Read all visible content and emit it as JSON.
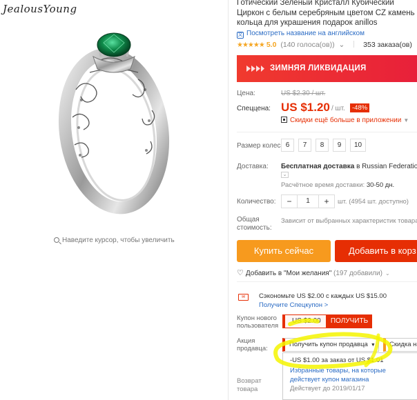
{
  "brand": "JealousYoung",
  "zoom_hint": "Наведите курсор, чтобы увеличить",
  "product": {
    "title": "Готический Зеленый Кристалл Кубический Циркон с белым серебряным цветом CZ камень кольца для украшения подарок anillos",
    "translate_label": "Посмотреть название на английском",
    "rating_stars": "★★★★★",
    "rating_score": "5.0",
    "rating_votes": "(140 голоса(ов))",
    "orders": "353 заказа(ов)"
  },
  "banner": {
    "text": "ЗИМНЯЯ ЛИКВИДАЦИЯ"
  },
  "price": {
    "label_price": "Цена:",
    "old": "US $2.30 / шт.",
    "label_special": "Спеццена:",
    "new": "US $1.20",
    "per": "/ шт.",
    "discount": "-48%",
    "app_deal": "Скидки ещё больше в приложении",
    "app_caret": "▼"
  },
  "size": {
    "label": "Размер колеса:",
    "options": [
      "6",
      "7",
      "8",
      "9",
      "10"
    ]
  },
  "shipping": {
    "label": "Доставка:",
    "text": "Бесплатная доставка",
    "to": "в Russian Federation с",
    "time_label": "Расчётное время доставки:",
    "time": "30-50 дн."
  },
  "quantity": {
    "label": "Количество:",
    "minus": "−",
    "value": "1",
    "plus": "+",
    "note": "шт. (4954 шт. доступно)"
  },
  "total": {
    "label": "Общая стоимость:",
    "note": "Зависит от выбранных характеристик товара"
  },
  "buttons": {
    "buy": "Купить сейчас",
    "cart": "Добавить в корз"
  },
  "wishlist": {
    "label": "Добавить в \"Мои желания\"",
    "count": "(197 добавили)"
  },
  "coupon": {
    "save_text": "Сэкономьте US $2.00 с каждых US $15.00",
    "link": "Получите Спецкупон >",
    "new_user_label": "Купон нового пользователя",
    "new_user_value": "US $2.00",
    "get_button": "ПОЛУЧИТЬ"
  },
  "promo": {
    "label": "Акция продавца:",
    "seller_coupon": "Получить купон продавца",
    "discount_tag": "Скидка на",
    "dropdown_line1": "-US $1.00 за заказ от US $1.01",
    "dropdown_line2": "Избранные товары, на которые действует купон магазина",
    "dropdown_line3": "Действует до 2019/01/17"
  },
  "returns": {
    "label": "Возврат товара"
  },
  "colors": {
    "accent_red": "#e62e04",
    "accent_orange": "#f79a1e",
    "link_blue": "#2a6bc4",
    "star_yellow": "#f5a623",
    "highlight_yellow": "#f5f500"
  }
}
